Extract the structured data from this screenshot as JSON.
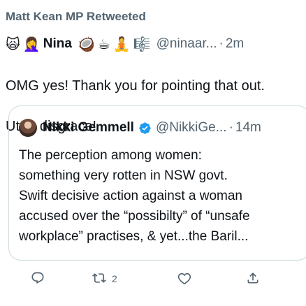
{
  "context": {
    "retweeted_by": "Matt Kean MP Retweeted"
  },
  "tweet": {
    "emojis_before_name": [
      "🙀",
      "🤦‍♀️"
    ],
    "author_name": "Nina",
    "emojis_after_name": [
      "🥥",
      "☕",
      "🧘",
      "🎼"
    ],
    "handle": "@ninaar...",
    "separator": "·",
    "time": "2m",
    "text_lines": [
      "OMG yes!  Thank you for pointing that out.",
      "Utter disgrace!"
    ]
  },
  "quote": {
    "author_name": "Nikki Gemmell",
    "verified_icon": "verified-badge-icon",
    "handle": "@NikkiGe...",
    "separator": "·",
    "time": "14m",
    "text_lines": [
      "The perception among women:",
      "something very rotten in NSW govt.",
      "Swift decisive action against a woman",
      "accused over the “possibilty” of “unsafe",
      "workplace” practises, &  yet...the Baril..."
    ]
  },
  "actions": {
    "reply_icon": "reply-icon",
    "retweet_icon": "retweet-icon",
    "retweet_count": "2",
    "like_icon": "heart-icon",
    "share_icon": "share-icon"
  },
  "colors": {
    "accent": "#1d9bf0",
    "secondary_text": "#536471",
    "border": "#cfd9de"
  }
}
